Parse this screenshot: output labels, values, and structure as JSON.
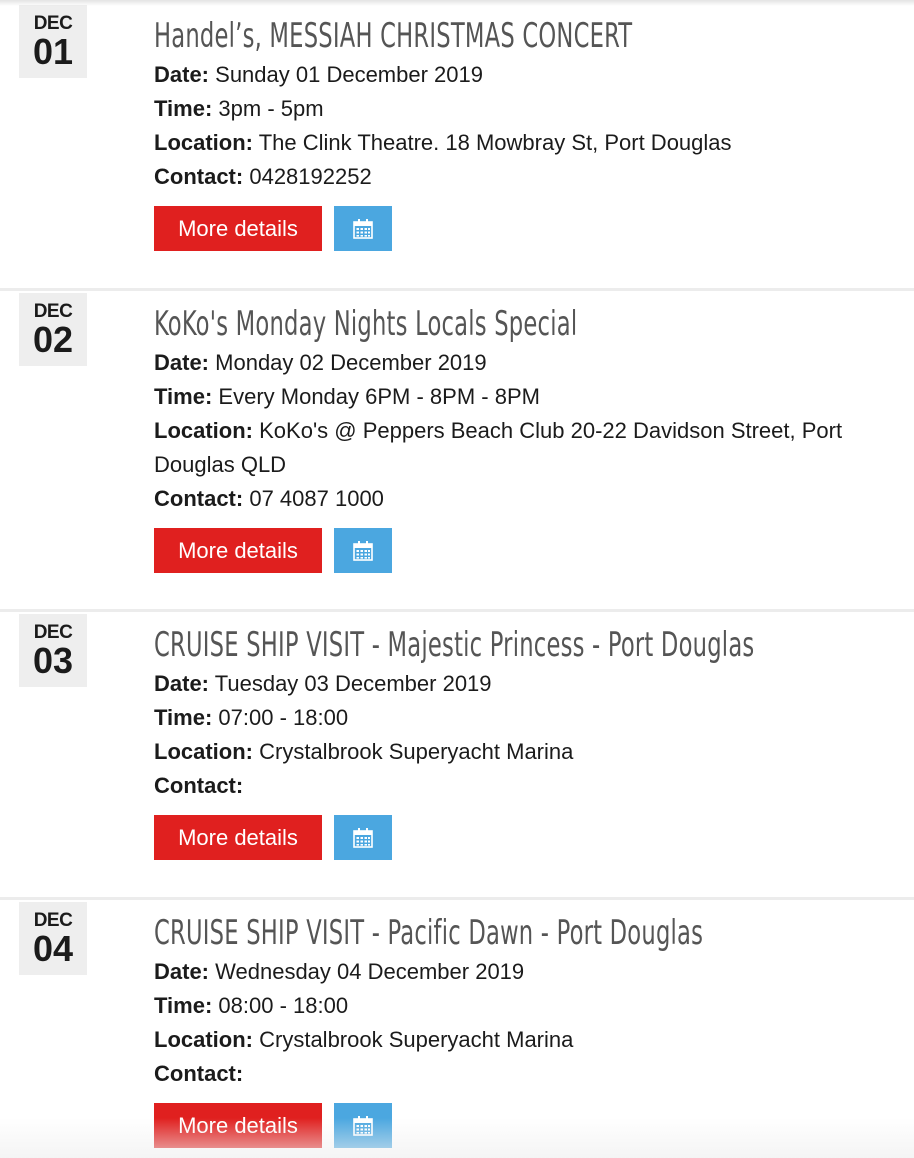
{
  "labels": {
    "date": "Date:",
    "time": "Time:",
    "location": "Location:",
    "contact": "Contact:",
    "more_details": "More details"
  },
  "icons": {
    "calendar": "calendar-icon"
  },
  "colors": {
    "more_button": "#e0201f",
    "calendar_button": "#4ba7e0",
    "title": "#555555",
    "badge_bg": "#eeeeee"
  },
  "events": [
    {
      "month": "DEC",
      "day": "01",
      "title": "Handel’s, MESSIAH CHRISTMAS CONCERT",
      "date": "Sunday 01 December 2019",
      "time": "3pm - 5pm",
      "location_line1": "The Clink Theatre. 18 Mowbray St, Port Douglas",
      "location_line2": "",
      "contact": "0428192252"
    },
    {
      "month": "DEC",
      "day": "02",
      "title": "KoKo's Monday Nights Locals Special",
      "date": "Monday 02 December 2019",
      "time": "Every Monday 6PM - 8PM - 8PM",
      "location_line1": "KoKo's @ Peppers Beach Club 20-22 Davidson Street, Port",
      "location_line2": "Douglas QLD",
      "contact": "07 4087 1000"
    },
    {
      "month": "DEC",
      "day": "03",
      "title": "CRUISE SHIP VISIT - Majestic Princess - Port Douglas",
      "date": "Tuesday 03 December 2019",
      "time": "07:00 - 18:00",
      "location_line1": "Crystalbrook Superyacht Marina",
      "location_line2": "",
      "contact": ""
    },
    {
      "month": "DEC",
      "day": "04",
      "title": "CRUISE SHIP VISIT - Pacific Dawn - Port Douglas",
      "date": "Wednesday 04 December 2019",
      "time": "08:00 - 18:00",
      "location_line1": "Crystalbrook Superyacht Marina",
      "location_line2": "",
      "contact": ""
    }
  ]
}
